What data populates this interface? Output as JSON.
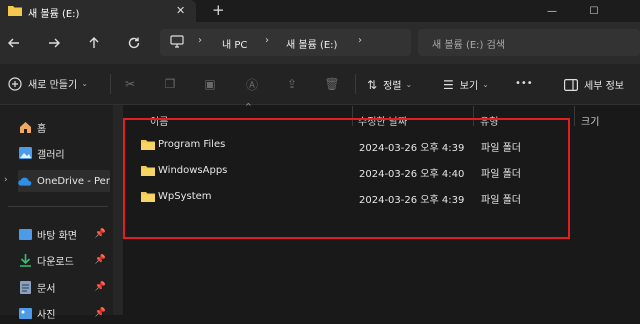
{
  "window": {
    "tab_title": "새 볼륨 (E:)",
    "new_tab": "+",
    "close_tab": "✕",
    "minimize": "—",
    "maximize": "☐"
  },
  "nav": {
    "breadcrumb": [
      "내 PC",
      "새 볼륨 (E:)"
    ],
    "search_placeholder": "새 볼륨 (E:) 검색"
  },
  "toolbar": {
    "new_label": "새로 만들기",
    "sort_label": "정렬",
    "view_label": "보기",
    "more_label": "•••",
    "details_label": "세부 정보"
  },
  "sidebar": {
    "items": [
      {
        "label": "홈",
        "icon": "home-icon",
        "pinned": false
      },
      {
        "label": "갤러리",
        "icon": "gallery-icon",
        "pinned": false
      },
      {
        "label": "OneDrive - Pers",
        "icon": "cloud-icon",
        "pinned": false
      },
      {
        "label": "바탕 화면",
        "icon": "desktop-icon",
        "pinned": true
      },
      {
        "label": "다운로드",
        "icon": "download-icon",
        "pinned": true
      },
      {
        "label": "문서",
        "icon": "document-icon",
        "pinned": true
      },
      {
        "label": "사진",
        "icon": "pictures-icon",
        "pinned": true
      }
    ]
  },
  "columns": {
    "name": "이름",
    "modified": "수정한 날짜",
    "type": "유형",
    "size": "크기"
  },
  "files": [
    {
      "name": "Program Files",
      "modified": "2024-03-26 오후 4:39",
      "type": "파일 폴더"
    },
    {
      "name": "WindowsApps",
      "modified": "2024-03-26 오후 4:40",
      "type": "파일 폴더"
    },
    {
      "name": "WpSystem",
      "modified": "2024-03-26 오후 4:39",
      "type": "파일 폴더"
    }
  ],
  "colors": {
    "folder": "#f2c94c",
    "accent_blue": "#4c9be8",
    "highlight_box": "#e02020"
  }
}
